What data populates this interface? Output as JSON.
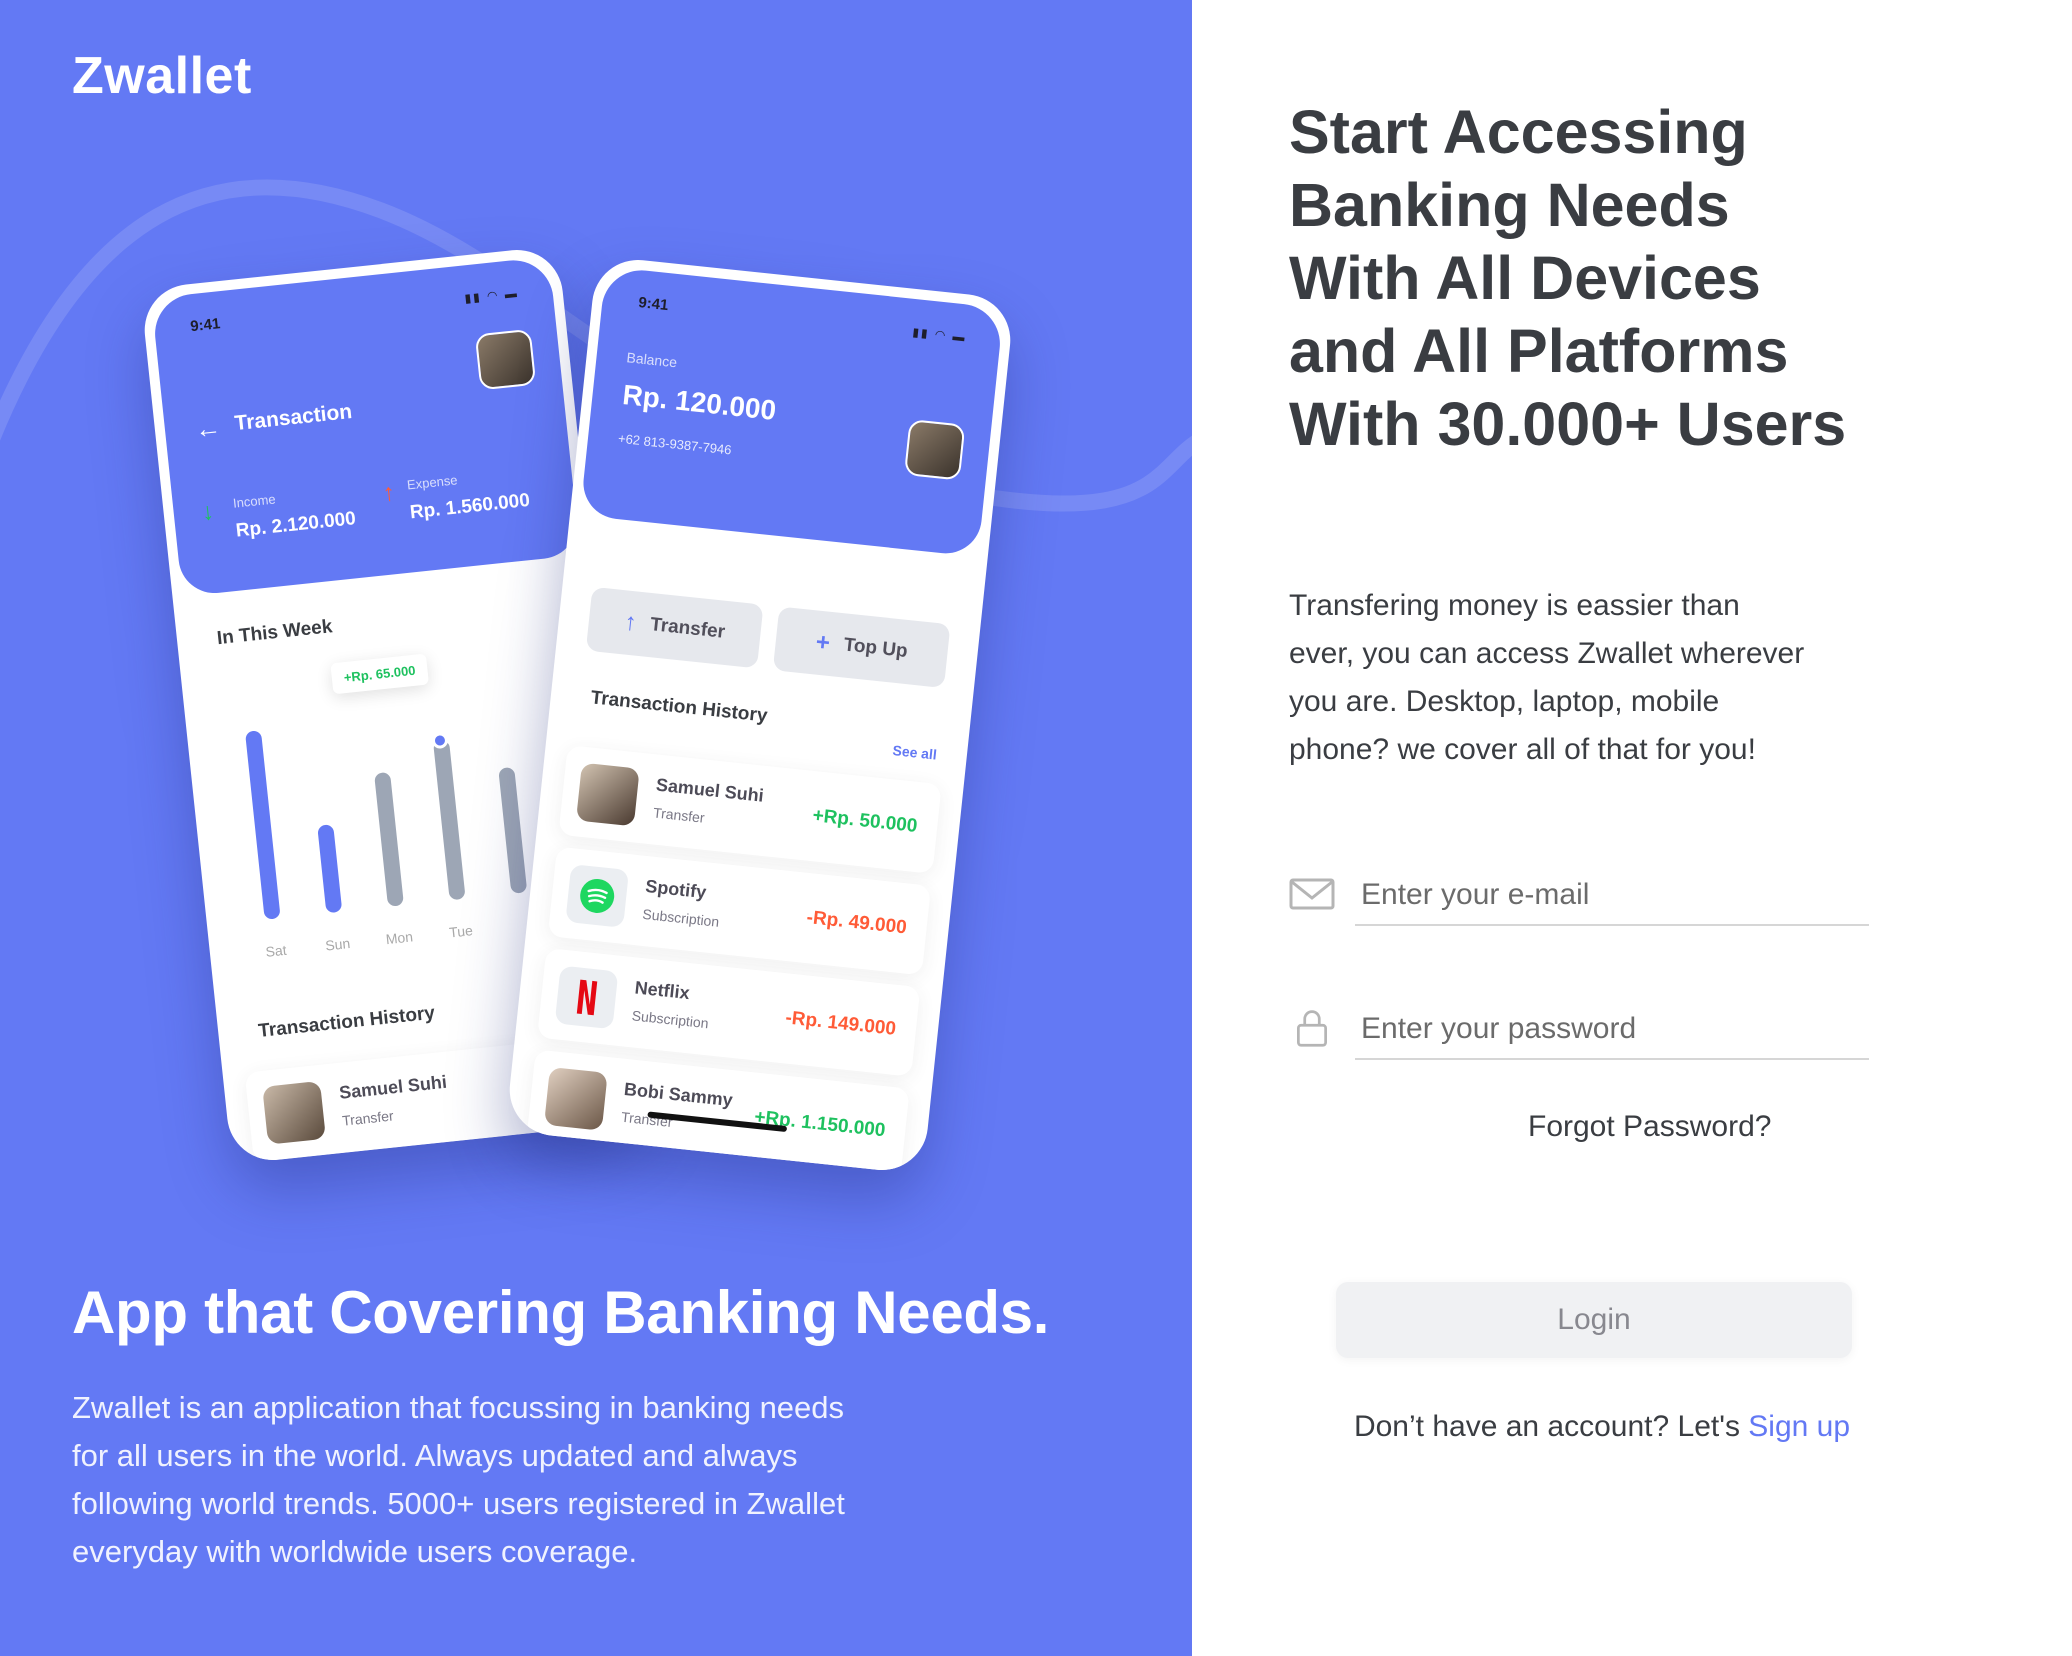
{
  "brand": "Zwallet",
  "left": {
    "headline": "App that Covering Banking Needs.",
    "description": "Zwallet is an application that focussing in banking needs for all users in the world. Always updated and always following world trends. 5000+ users registered in Zwallet everyday with worldwide users coverage."
  },
  "phone1": {
    "time": "9:41",
    "title": "Transaction",
    "income_label": "Income",
    "income": "Rp. 2.120.000",
    "expense_label": "Expense",
    "expense": "Rp. 1.560.000",
    "week_title": "In This Week",
    "tooltip": "+Rp. 65.000",
    "days": [
      "Sat",
      "Sun",
      "Mon",
      "Tue"
    ],
    "bar_levels": [
      0.9,
      0.42,
      0.64,
      0.76,
      0.6
    ],
    "history_title": "Transaction History",
    "row_name": "Samuel Suhi",
    "row_sub": "Transfer"
  },
  "phone2": {
    "time": "9:41",
    "balance_label": "Balance",
    "balance": "Rp. 120.000",
    "phone": "+62 813-9387-7946",
    "transfer": "Transfer",
    "topup": "Top Up",
    "history_title": "Transaction History",
    "see_all": "See all",
    "transactions": [
      {
        "name": "Samuel Suhi",
        "type": "Transfer",
        "amount": "+Rp. 50.000"
      },
      {
        "name": "Spotify",
        "type": "Subscription",
        "amount": "-Rp. 49.000"
      },
      {
        "name": "Netflix",
        "type": "Subscription",
        "amount": "-Rp. 149.000"
      },
      {
        "name": "Bobi Sammy",
        "type": "Transfer",
        "amount": "+Rp. 1.150.000"
      }
    ]
  },
  "right": {
    "title": "Start Accessing Banking Needs With All Devices and All Platforms With 30.000+ Users",
    "description": "Transfering money is eassier than ever, you can access Zwallet wherever you are. Desktop, laptop, mobile phone? we cover all of that for you!",
    "email_placeholder": "Enter your e-mail",
    "password_placeholder": "Enter your password",
    "forgot": "Forgot Password?",
    "login": "Login",
    "signup_prefix": "Don’t have an account? Let's",
    "signup_link": "Sign up"
  },
  "colors": {
    "primary": "#6379F4",
    "positive": "#1EC15F",
    "negative": "#FF5B37",
    "text": "#3A3D42"
  },
  "icons": [
    "mail-icon",
    "lock-icon",
    "arrow-left-icon",
    "arrow-up-icon",
    "plus-icon",
    "arrow-down-icon"
  ]
}
